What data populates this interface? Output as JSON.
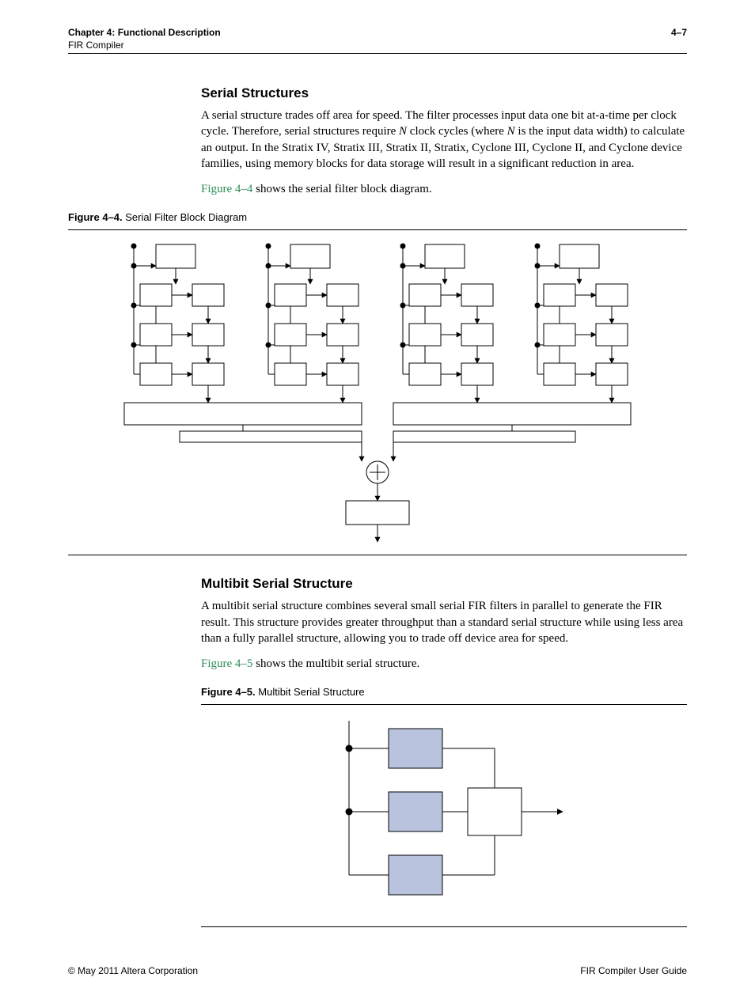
{
  "header": {
    "chapter_label": "Chapter 4:",
    "chapter_title": "Functional Description",
    "subline": "FIR Compiler",
    "page_number": "4–7"
  },
  "section1": {
    "heading": "Serial Structures",
    "paragraph_part1": "A serial structure trades off area for speed. The filter processes input data one bit at-a-time per clock cycle. Therefore, serial structures require ",
    "paragraph_italic1": "N",
    "paragraph_part2": " clock cycles (where ",
    "paragraph_italic2": "N",
    "paragraph_part3": " is the input data width) to calculate an output. In the Stratix IV, Stratix III, Stratix II, Stratix, Cyclone III, Cyclone II, and Cyclone device families, using memory blocks for data storage will result in a significant reduction in area.",
    "ref_sentence_link": "Figure 4–4",
    "ref_sentence_rest": " shows the serial filter block diagram."
  },
  "figure1": {
    "label": "Figure 4–4.",
    "title": "Serial Filter Block Diagram"
  },
  "section2": {
    "heading": "Multibit Serial Structure",
    "paragraph": "A multibit serial structure combines several small serial FIR filters in parallel to generate the FIR result. This structure provides greater throughput than a standard serial structure while using less area than a fully parallel structure, allowing you to trade off device area for speed.",
    "ref_sentence_link": "Figure 4–5",
    "ref_sentence_rest": " shows the multibit serial structure."
  },
  "figure2": {
    "label": "Figure 4–5.",
    "title": "Multibit Serial Structure"
  },
  "footer": {
    "left": "© May 2011   Altera Corporation",
    "right": "FIR Compiler User Guide"
  }
}
